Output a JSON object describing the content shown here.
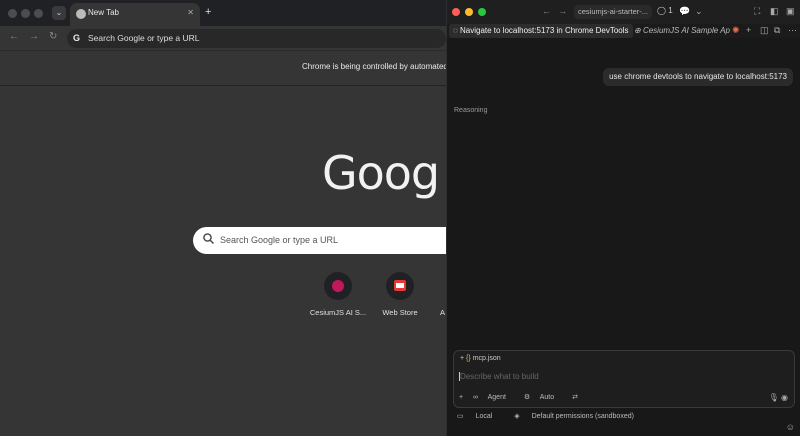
{
  "browser": {
    "tab": {
      "title": "New Tab"
    },
    "omnibox": {
      "placeholder": "Search Google or type a URL"
    },
    "infobar": {
      "text": "Chrome is being controlled by automated"
    },
    "ntp": {
      "logo": "Goog",
      "search_placeholder": "Search Google or type a URL",
      "shortcuts": [
        {
          "name": "CesiumJS AI S...",
          "icon": "cesium-icon"
        },
        {
          "name": "Web Store",
          "icon": "web-store-icon"
        }
      ],
      "partial_shortcut": "A"
    }
  },
  "agent_panel": {
    "titlebar": {
      "address": "cesiumjs-ai-starter-...",
      "count": "1"
    },
    "tabs": [
      {
        "label": "Navigate to localhost:5173 in Chrome DevTools"
      },
      {
        "label": "CesiumJS AI Sample Ap"
      }
    ],
    "user_message": "use chrome devtools to navigate to localhost:5173",
    "reasoning_label": "Reasoning",
    "composer": {
      "context_file": "mcp.json",
      "placeholder": "Describe what to build",
      "mode": "Agent",
      "model": "Auto"
    },
    "status": {
      "location": "Local",
      "permissions": "Default permissions (sandboxed)"
    }
  },
  "colors": {
    "panel_bg": "#181818",
    "browser_bg": "#353535",
    "accent_red": "#c2185b"
  }
}
